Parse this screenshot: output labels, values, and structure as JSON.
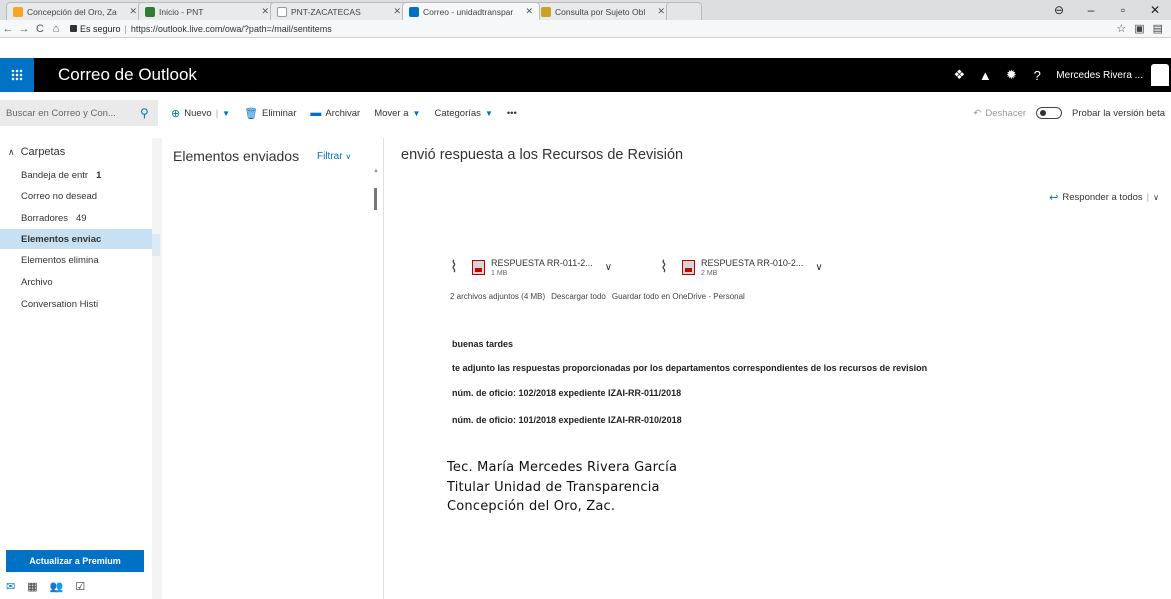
{
  "browser": {
    "tabs": [
      {
        "label": "Concepción del Oro, Za",
        "active": false,
        "color": "#f5a623"
      },
      {
        "label": "Inicio - PNT",
        "active": false,
        "color": "#2e7d32"
      },
      {
        "label": "PNT-ZACATECAS",
        "active": false,
        "color": "#9e9e9e"
      },
      {
        "label": "Correo - unidadtranspar",
        "active": true,
        "color": "#0072c6"
      },
      {
        "label": "Consulta por Sujeto Obl",
        "active": false,
        "color": "#c9a227"
      }
    ],
    "secure_label": "Es seguro",
    "url": "https://outlook.live.com/owa/?path=/mail/sentitems"
  },
  "suite": {
    "app_title": "Correo de Outlook",
    "user_name": "Mercedes Rivera ..."
  },
  "commands": {
    "search_placeholder": "Buscar en Correo y Con...",
    "new": "Nuevo",
    "delete": "Eliminar",
    "archive": "Archivar",
    "move_to": "Mover a",
    "categories": "Categorías",
    "more": "•••",
    "undo": "Deshacer",
    "beta": "Probar la versión beta"
  },
  "folders": {
    "header": "Carpetas",
    "items": [
      {
        "label": "Bandeja de entr",
        "count": "1"
      },
      {
        "label": "Correo no desead",
        "count": ""
      },
      {
        "label": "Borradores",
        "count": "49"
      },
      {
        "label": "Elementos enviac",
        "count": "",
        "selected": true
      },
      {
        "label": "Elementos elimina",
        "count": ""
      },
      {
        "label": "Archivo",
        "count": ""
      },
      {
        "label": "Conversation Histi",
        "count": ""
      }
    ],
    "premium_button": "Actualizar a Premium"
  },
  "message_list": {
    "title": "Elementos enviados",
    "filter": "Filtrar"
  },
  "reading": {
    "subject": "envió respuesta a los Recursos de Revisión",
    "reply_all": "Responder a todos",
    "attachments": [
      {
        "name": "RESPUESTA RR-011-2...",
        "size": "1 MB"
      },
      {
        "name": "RESPUESTA RR-010-2...",
        "size": "2 MB"
      }
    ],
    "attachments_summary": "2 archivos adjuntos (4 MB)",
    "download_all": "Descargar todo",
    "save_onedrive": "Guardar todo en OneDrive - Personal",
    "body": {
      "greeting": "buenas tardes",
      "line1": "te adjunto las respuestas proporcionadas por los departamentos correspondientes de los recursos de revision",
      "line2": "núm. de oficio: 102/2018   expediente IZAI-RR-011/2018",
      "line3": "núm. de oficio: 101/2018   expediente IZAI-RR-010/2018"
    },
    "signature": {
      "name": "Tec. María Mercedes Rivera García",
      "title": "Titular Unidad de Transparencia",
      "place": "Concepción del Oro, Zac."
    }
  }
}
